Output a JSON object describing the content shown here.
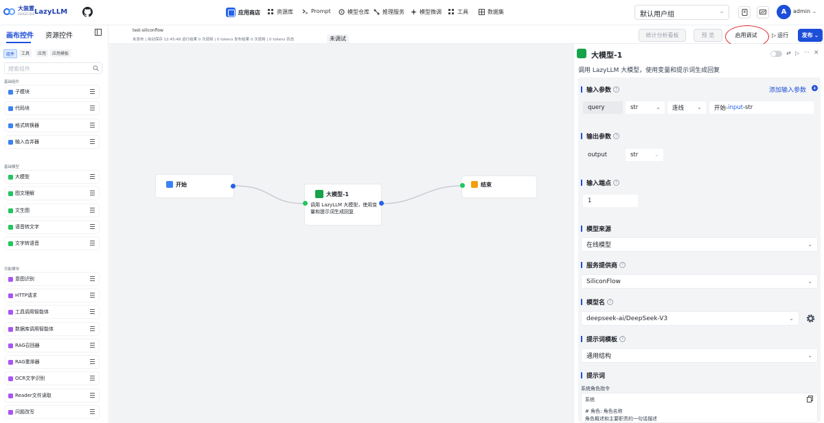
{
  "topnav": {
    "brand": "大装置",
    "brand_sub": "SENSECORE",
    "product": "LazyLLM",
    "items": [
      {
        "label": "应用商店",
        "icon": "store-icon",
        "active": true
      },
      {
        "label": "资源库",
        "icon": "grid-icon"
      },
      {
        "label": "Prompt",
        "icon": "prompt-icon"
      },
      {
        "label": "模型仓库",
        "icon": "cube-icon"
      },
      {
        "label": "推理服务",
        "icon": "network-icon"
      },
      {
        "label": "模型微调",
        "icon": "tune-icon"
      },
      {
        "label": "工具",
        "icon": "tools-icon"
      },
      {
        "label": "数据集",
        "icon": "dataset-icon"
      }
    ],
    "usergroup": "默认用户组",
    "user": "admin",
    "avatar_letter": "A"
  },
  "leftpanel": {
    "tabs": [
      "画布控件",
      "资源控件"
    ],
    "chips": [
      "组件",
      "工具",
      "应用",
      "应用模板"
    ],
    "search_placeholder": "搜索组件",
    "sections": [
      {
        "title": "基础组件",
        "items": [
          {
            "label": "子模块",
            "color": "#3b82f6"
          },
          {
            "label": "代码块",
            "color": "#3b82f6"
          },
          {
            "label": "格式转换器",
            "color": "#3b82f6"
          },
          {
            "label": "输入合并器",
            "color": "#3b82f6"
          }
        ]
      },
      {
        "title": "基础模型",
        "items": [
          {
            "label": "大模型",
            "color": "#22c55e"
          },
          {
            "label": "图文理解",
            "color": "#22c55e"
          },
          {
            "label": "文生图",
            "color": "#22c55e"
          },
          {
            "label": "语音转文字",
            "color": "#22c55e"
          },
          {
            "label": "文字转语音",
            "color": "#22c55e"
          }
        ]
      },
      {
        "title": "功能模块",
        "items": [
          {
            "label": "意图识别",
            "color": "#a855f7"
          },
          {
            "label": "HTTP请求",
            "color": "#a855f7"
          },
          {
            "label": "工具调用智能体",
            "color": "#a855f7"
          },
          {
            "label": "数据库调用智能体",
            "color": "#a855f7"
          },
          {
            "label": "RAG召回器",
            "color": "#a855f7"
          },
          {
            "label": "RAG重排器",
            "color": "#a855f7"
          },
          {
            "label": "OCR文字识别",
            "color": "#a855f7"
          },
          {
            "label": "Reader文件读取",
            "color": "#a855f7"
          },
          {
            "label": "问题改写",
            "color": "#a855f7"
          }
        ]
      }
    ]
  },
  "header": {
    "title": "test-siliconflow",
    "meta": "未发布 | 自动保存 12:45:48      运行结果  0 次调用 | 0 tokens   发布结果  0 次调用 | 0 tokens   状态",
    "status": "未调试",
    "buttons": {
      "stats": "统计分析看板",
      "preview": "预 览",
      "debug": "启用调试",
      "run": "运行",
      "publish": "发布"
    }
  },
  "canvas": {
    "nodes": {
      "start": {
        "label": "开始"
      },
      "llm": {
        "label": "大模型-1",
        "desc": "调用 LazyLLM 大模型，使用变量和提示词生成回复"
      },
      "end": {
        "label": "结束"
      }
    }
  },
  "rightpanel": {
    "title": "大模型-1",
    "desc": "调用 LazyLLM 大模型，使用变量和提示词生成回复",
    "input_params": {
      "label": "输入参数",
      "add": "添加输入参数",
      "name": "query",
      "type": "str",
      "mode": "连线",
      "source_a": "开始-",
      "source_b": "input",
      "source_c": "-str"
    },
    "output_params": {
      "label": "输出参数",
      "name": "output",
      "type": "str"
    },
    "input_ports": {
      "label": "输入端点",
      "value": "1"
    },
    "model_source": {
      "label": "模型来源",
      "value": "在线模型"
    },
    "provider": {
      "label": "服务提供商",
      "value": "SiliconFlow"
    },
    "model_name": {
      "label": "模型名",
      "value": "deepseek-ai/DeepSeek-V3"
    },
    "template": {
      "label": "提示词模板",
      "value": "通用结构"
    },
    "prompt": {
      "label": "提示词",
      "system_label": "系统角色指令",
      "system": "系统",
      "line1": "# 角色: 角色名称",
      "line2": "角色概述和主要职责的一句话描述"
    }
  }
}
